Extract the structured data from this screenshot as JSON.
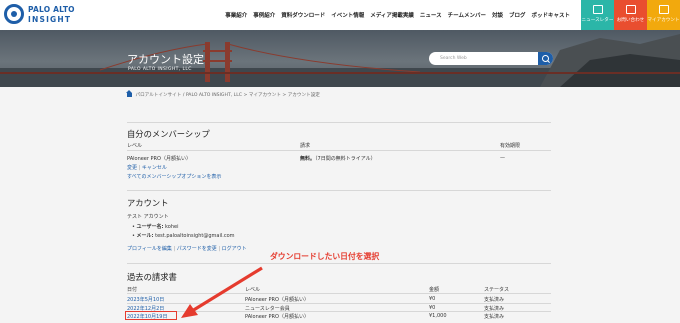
{
  "header": {
    "logo_line1": "PALO ALTO",
    "logo_line2": "INSIGHT",
    "nav": [
      "事業紹介",
      "事例紹介",
      "資料ダウンロード",
      "イベント情報",
      "メディア掲載実績",
      "ニュース",
      "チームメンバー",
      "対談",
      "ブログ",
      "ポッドキャスト"
    ],
    "buttons": [
      {
        "label": "ニュースレター",
        "color": "#2bb6a8",
        "icon": "newsletter-icon"
      },
      {
        "label": "お問い合わせ",
        "color": "#e94e2f",
        "icon": "mail-icon"
      },
      {
        "label": "マイアカウント",
        "color": "#f2a90d",
        "icon": "account-icon"
      }
    ]
  },
  "hero": {
    "title": "アカウント設定",
    "subtitle": "PALO ALTO INSIGHT, LLC",
    "search_placeholder": "Search Web"
  },
  "breadcrumb": "パロアルトインサイト / PALO ALTO INSIGHT, LLC > マイアカウント > アカウント設定",
  "membership": {
    "title": "自分のメンバーシップ",
    "headers": {
      "level": "レベル",
      "billing": "請求",
      "expiry": "有効期限"
    },
    "row": {
      "level": "PAloneer PRO（月額払い）",
      "billing_bold": "無料。",
      "billing_rest": "（7日間の無料トライアル）",
      "expiry": "—"
    },
    "links": {
      "change": "変更",
      "cancel": "キャンセル",
      "all_options": "すべてのメンバーシップオプションを表示"
    }
  },
  "account": {
    "title": "アカウント",
    "name": "テスト アカウント",
    "username_label": "ユーザー名:",
    "username": "kohei",
    "email_label": "メール:",
    "email": "test.paloaltoinsight@gmail.com",
    "links": {
      "edit_profile": "プロフィールを編集",
      "change_password": "パスワードを変更",
      "logout": "ログアウト"
    }
  },
  "invoices": {
    "title": "過去の請求書",
    "headers": {
      "date": "日付",
      "level": "レベル",
      "amount": "金額",
      "status": "ステータス"
    },
    "rows": [
      {
        "date": "2023年5月10日",
        "level": "PAloneer PRO（月額払い）",
        "amount": "¥0",
        "status": "支払済み"
      },
      {
        "date": "2022年12月2日",
        "level": "ニュースレター会員",
        "amount": "¥0",
        "status": "支払済み"
      },
      {
        "date": "2022年10月19日",
        "level": "PAloneer PRO（月額払い）",
        "amount": "¥1,000",
        "status": "支払済み"
      }
    ]
  },
  "annotation": {
    "text": "ダウンロードしたい日付を選択",
    "color": "#e53b2e"
  }
}
